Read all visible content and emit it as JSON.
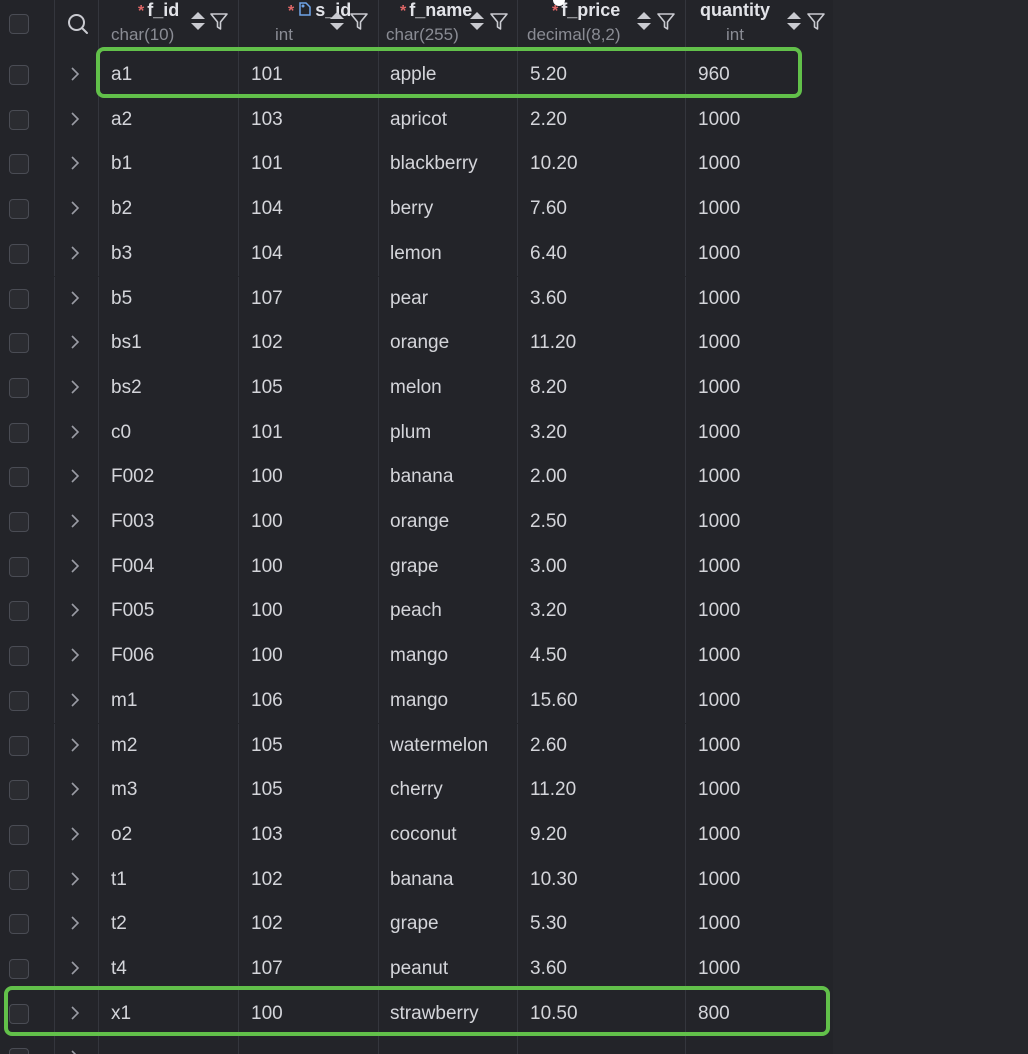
{
  "columns": [
    {
      "name": "f_id",
      "type": "char(10)",
      "required": true,
      "key": false
    },
    {
      "name": "s_id",
      "type": "int",
      "required": true,
      "key": true
    },
    {
      "name": "f_name",
      "type": "char(255)",
      "required": true,
      "key": false
    },
    {
      "name": "f_price",
      "type": "decimal(8,2)",
      "required": true,
      "key": false
    },
    {
      "name": "quantity",
      "type": "int",
      "required": false,
      "key": false
    }
  ],
  "rows": [
    [
      "a1",
      "101",
      "apple",
      "5.20",
      "960"
    ],
    [
      "a2",
      "103",
      "apricot",
      "2.20",
      "1000"
    ],
    [
      "b1",
      "101",
      "blackberry",
      "10.20",
      "1000"
    ],
    [
      "b2",
      "104",
      "berry",
      "7.60",
      "1000"
    ],
    [
      "b3",
      "104",
      "lemon",
      "6.40",
      "1000"
    ],
    [
      "b5",
      "107",
      "pear",
      "3.60",
      "1000"
    ],
    [
      "bs1",
      "102",
      "orange",
      "11.20",
      "1000"
    ],
    [
      "bs2",
      "105",
      "melon",
      "8.20",
      "1000"
    ],
    [
      "c0",
      "101",
      "plum",
      "3.20",
      "1000"
    ],
    [
      "F002",
      "100",
      "banana",
      "2.00",
      "1000"
    ],
    [
      "F003",
      "100",
      "orange",
      "2.50",
      "1000"
    ],
    [
      "F004",
      "100",
      "grape",
      "3.00",
      "1000"
    ],
    [
      "F005",
      "100",
      "peach",
      "3.20",
      "1000"
    ],
    [
      "F006",
      "100",
      "mango",
      "4.50",
      "1000"
    ],
    [
      "m1",
      "106",
      "mango",
      "15.60",
      "1000"
    ],
    [
      "m2",
      "105",
      "watermelon",
      "2.60",
      "1000"
    ],
    [
      "m3",
      "105",
      "cherry",
      "11.20",
      "1000"
    ],
    [
      "o2",
      "103",
      "coconut",
      "9.20",
      "1000"
    ],
    [
      "t1",
      "102",
      "banana",
      "10.30",
      "1000"
    ],
    [
      "t2",
      "102",
      "grape",
      "5.30",
      "1000"
    ],
    [
      "t4",
      "107",
      "peanut",
      "3.60",
      "1000"
    ],
    [
      "x1",
      "100",
      "strawberry",
      "10.50",
      "800"
    ]
  ],
  "icons": {
    "search": "search-icon",
    "sort": "sort-icon",
    "filter": "filter-icon",
    "expand": "chevron-right-icon",
    "key": "key-icon"
  },
  "colors": {
    "highlight": "#62c04a",
    "required_marker": "#e06767",
    "background": "#232429"
  },
  "highlighted_rows": [
    0,
    21
  ]
}
